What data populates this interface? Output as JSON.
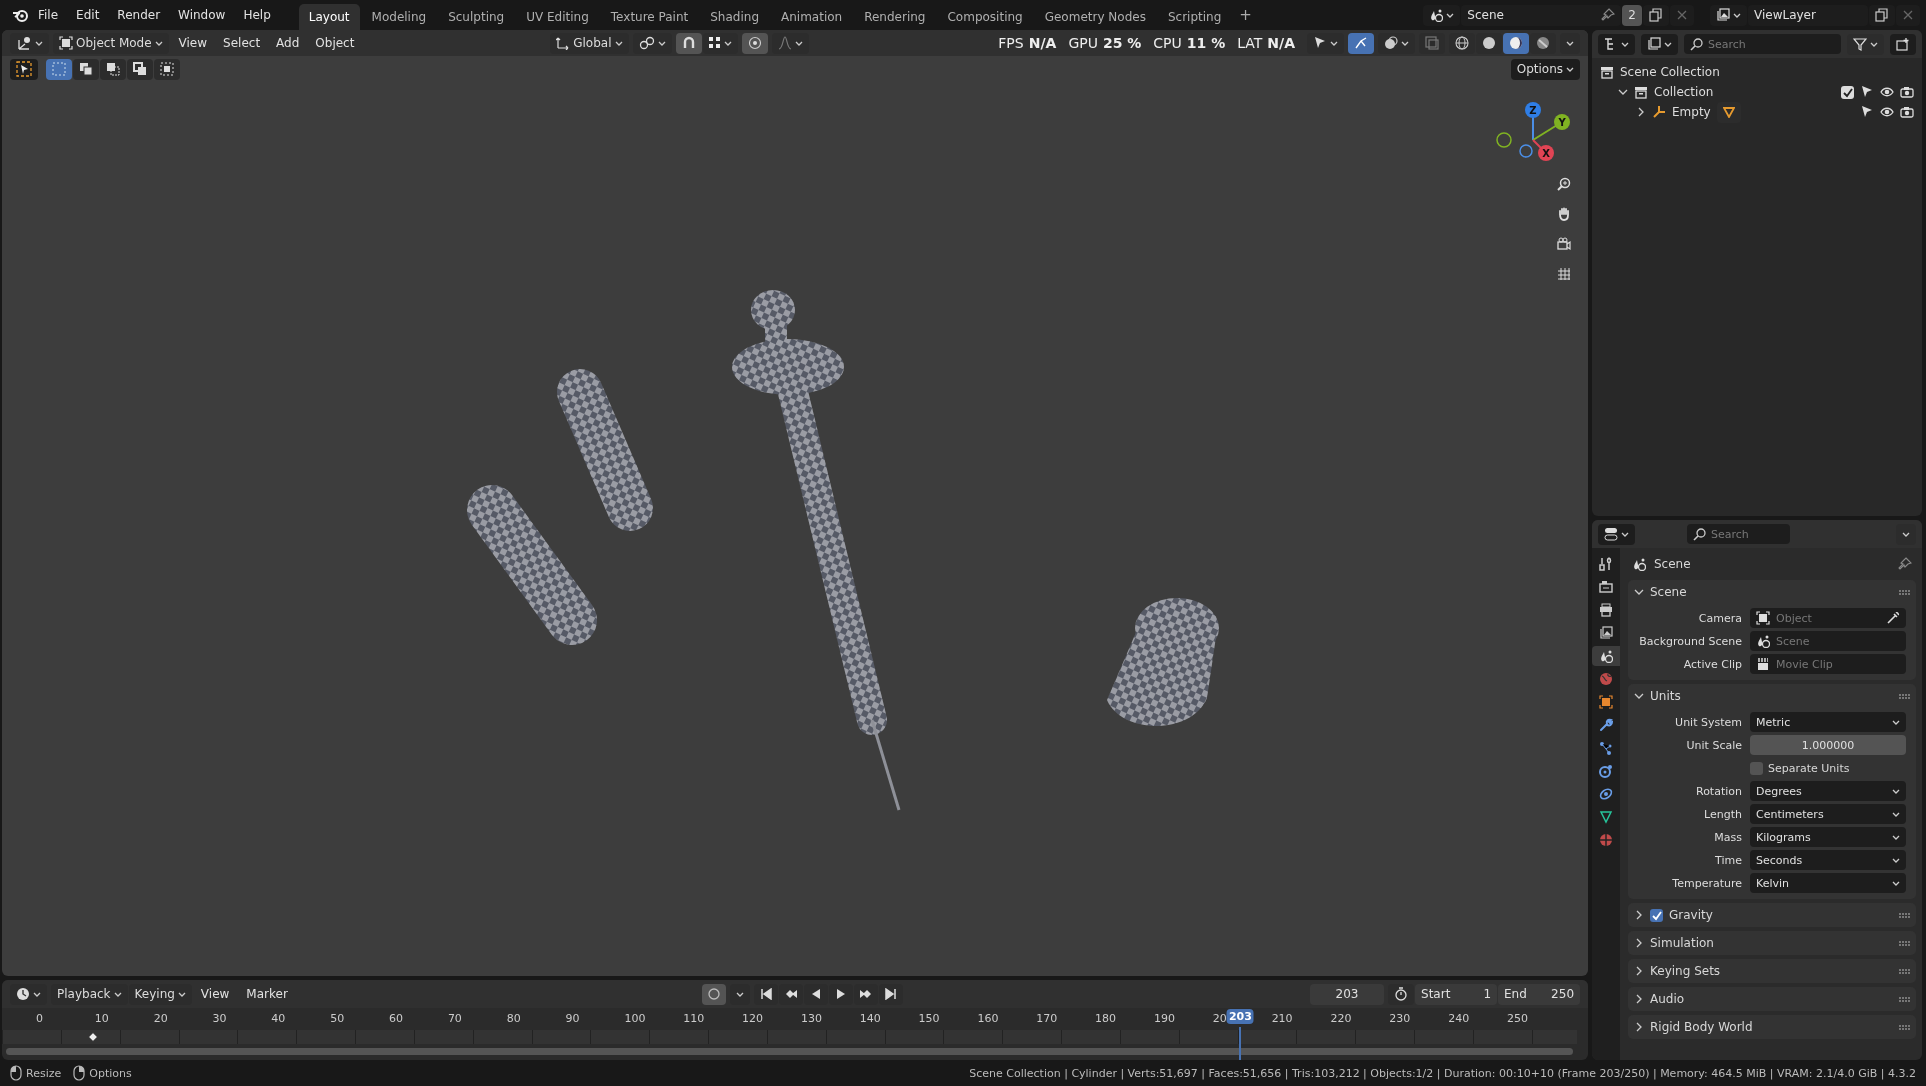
{
  "top_bar": {
    "menus": [
      "File",
      "Edit",
      "Render",
      "Window",
      "Help"
    ],
    "workspaces": [
      {
        "label": "Layout",
        "selected": true
      },
      {
        "label": "Modeling",
        "selected": false
      },
      {
        "label": "Sculpting",
        "selected": false
      },
      {
        "label": "UV Editing",
        "selected": false
      },
      {
        "label": "Texture Paint",
        "selected": false
      },
      {
        "label": "Shading",
        "selected": false
      },
      {
        "label": "Animation",
        "selected": false
      },
      {
        "label": "Rendering",
        "selected": false
      },
      {
        "label": "Compositing",
        "selected": false
      },
      {
        "label": "Geometry Nodes",
        "selected": false
      },
      {
        "label": "Scripting",
        "selected": false
      }
    ],
    "add_workspace": "+",
    "scene": {
      "name": "Scene",
      "users": "2"
    },
    "view_layer": {
      "name": "ViewLayer"
    }
  },
  "viewport": {
    "header": {
      "mode": "Object Mode",
      "menus": [
        "View",
        "Select",
        "Add",
        "Object"
      ],
      "orientation": "Global",
      "toggles": [
        {
          "kind": "gizmo",
          "on": true
        },
        {
          "kind": "overlay",
          "on": false
        }
      ],
      "shading": [
        {
          "kind": "wireframe",
          "selected": false
        },
        {
          "kind": "solid",
          "selected": false
        },
        {
          "kind": "material",
          "selected": true
        },
        {
          "kind": "rendered",
          "selected": false
        }
      ]
    },
    "stats": [
      {
        "label": "FPS",
        "value": "N/A"
      },
      {
        "label": "GPU",
        "value": "25 %"
      },
      {
        "label": "CPU",
        "value": "11 %"
      },
      {
        "label": "LAT",
        "value": "N/A"
      }
    ],
    "select_modes": [
      {
        "selected": true
      },
      {
        "selected": false
      },
      {
        "selected": false
      },
      {
        "selected": false
      },
      {
        "selected": false
      }
    ],
    "options": "Options",
    "gizmo_axes": [
      "Z",
      "Y",
      "X"
    ]
  },
  "outliner": {
    "search": {
      "placeholder": "Search"
    },
    "root": {
      "label": "Scene Collection",
      "children": [
        {
          "label": "Collection",
          "kind": "collection",
          "expanded": true,
          "checked": true,
          "children": [
            {
              "label": "Empty",
              "kind": "empty",
              "expanded": false
            }
          ]
        }
      ]
    }
  },
  "properties": {
    "search": {
      "placeholder": "Search"
    },
    "tabs": [
      {
        "kind": "tool",
        "selected": false
      },
      {
        "kind": "render",
        "selected": false
      },
      {
        "kind": "output",
        "selected": false
      },
      {
        "kind": "view_layer",
        "selected": false
      },
      {
        "kind": "scene",
        "selected": true
      },
      {
        "kind": "world",
        "selected": false
      },
      {
        "kind": "object",
        "selected": false
      },
      {
        "kind": "modifiers",
        "selected": false
      },
      {
        "kind": "particles",
        "selected": false
      },
      {
        "kind": "physics",
        "selected": false
      },
      {
        "kind": "constraints",
        "selected": false
      },
      {
        "kind": "data",
        "selected": false
      },
      {
        "kind": "material",
        "selected": false
      }
    ],
    "context": "Scene",
    "panels": [
      {
        "title": "Scene",
        "expanded": true,
        "fields": [
          {
            "label": "Camera",
            "kind": "object",
            "placeholder": "Object"
          },
          {
            "label": "Background Scene",
            "kind": "scene",
            "placeholder": "Scene"
          },
          {
            "label": "Active Clip",
            "kind": "clip",
            "placeholder": "Movie Clip"
          }
        ]
      },
      {
        "title": "Units",
        "expanded": true,
        "fields": [
          {
            "label": "Unit System",
            "kind": "dropdown",
            "value": "Metric"
          },
          {
            "label": "Unit Scale",
            "kind": "number",
            "value": "1.000000"
          },
          {
            "label": "Separate Units",
            "kind": "checkbox",
            "checked": false
          },
          {
            "label": "Rotation",
            "kind": "dropdown",
            "value": "Degrees"
          },
          {
            "label": "Length",
            "kind": "dropdown",
            "value": "Centimeters"
          },
          {
            "label": "Mass",
            "kind": "dropdown",
            "value": "Kilograms"
          },
          {
            "label": "Time",
            "kind": "dropdown",
            "value": "Seconds"
          },
          {
            "label": "Temperature",
            "kind": "dropdown",
            "value": "Kelvin"
          }
        ]
      },
      {
        "title": "Gravity",
        "expanded": false,
        "checked": true
      },
      {
        "title": "Simulation",
        "expanded": false
      },
      {
        "title": "Keying Sets",
        "expanded": false
      },
      {
        "title": "Audio",
        "expanded": false
      },
      {
        "title": "Rigid Body World",
        "expanded": false
      }
    ]
  },
  "timeline": {
    "menus": [
      {
        "label": "Playback",
        "kind": "dropdown"
      },
      {
        "label": "Keying",
        "kind": "dropdown"
      },
      {
        "label": "View",
        "kind": "menu"
      },
      {
        "label": "Marker",
        "kind": "menu"
      }
    ],
    "current_frame": "203",
    "start": {
      "label": "Start",
      "value": "1"
    },
    "end": {
      "label": "End",
      "value": "250"
    },
    "ruler": [
      "0",
      "10",
      "20",
      "30",
      "40",
      "50",
      "60",
      "70",
      "80",
      "90",
      "100",
      "110",
      "120",
      "130",
      "140",
      "150",
      "160",
      "170",
      "180",
      "190",
      "20",
      "210",
      "220",
      "230",
      "240",
      "250"
    ],
    "playhead": {
      "label": "203",
      "level": 0.812
    },
    "keyframes": [
      {
        "level": 0.032
      }
    ]
  },
  "status_bar": {
    "hints": [
      {
        "kind": "mouse_left",
        "label": "Resize"
      },
      {
        "kind": "mouse_right",
        "label": "Options"
      }
    ],
    "stats": "Scene Collection | Cylinder | Verts:51,697 | Faces:51,656 | Tris:103,212 | Objects:1/2 | Duration: 00:10+10 (Frame 203/250) | Memory: 464.5 MiB | VRAM: 2.1/4.0 GiB | 4.3.2"
  }
}
